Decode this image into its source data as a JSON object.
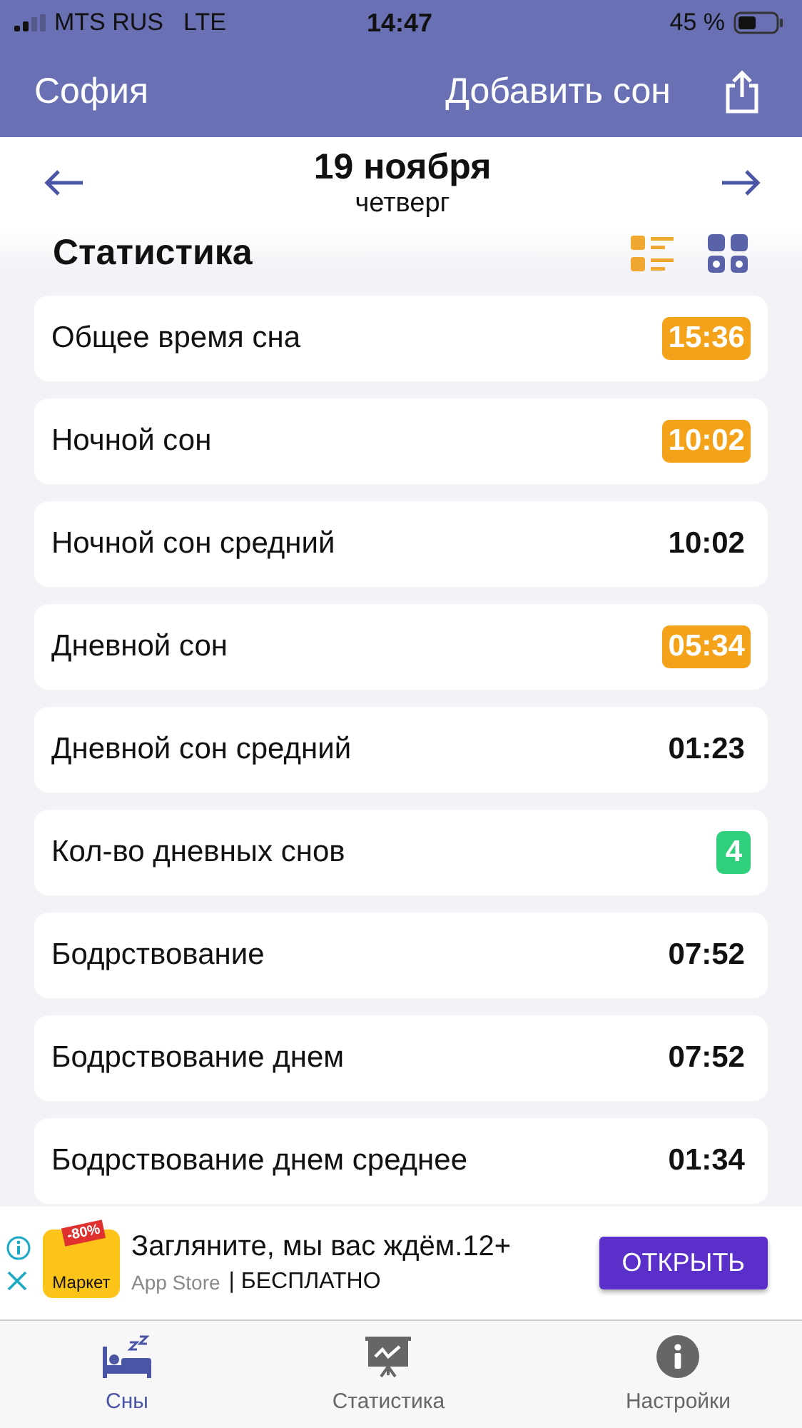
{
  "status_bar": {
    "carrier": "MTS RUS",
    "network": "LTE",
    "time": "14:47",
    "battery": "45 %"
  },
  "nav": {
    "title": "София",
    "action": "Добавить сон"
  },
  "date": {
    "day": "19 ноября",
    "weekday": "четверг"
  },
  "section": {
    "title": "Статистика",
    "views": [
      {
        "kind": "list",
        "selected": true
      },
      {
        "kind": "grid",
        "selected": false
      }
    ]
  },
  "rows": [
    {
      "label": "Общее время сна",
      "value": "15:36",
      "kind": "warning"
    },
    {
      "label": "Ночной сон",
      "value": "10:02",
      "kind": "warning"
    },
    {
      "label": "Ночной сон средний",
      "value": "10:02",
      "kind": "plain"
    },
    {
      "label": "Дневной сон",
      "value": "05:34",
      "kind": "warning"
    },
    {
      "label": "Дневной сон средний",
      "value": "01:23",
      "kind": "plain"
    },
    {
      "label": "Кол-во дневных снов",
      "value": "4",
      "kind": "count"
    },
    {
      "label": "Бодрствование",
      "value": "07:52",
      "kind": "plain"
    },
    {
      "label": "Бодрствование днем",
      "value": "07:52",
      "kind": "plain"
    },
    {
      "label": "Бодрствование днем среднее",
      "value": "01:34",
      "kind": "plain"
    }
  ],
  "ad": {
    "icon_badge": "-80%",
    "icon_label": "Маркет",
    "headline": "Загляните, мы вас ждём.12+",
    "store": "App Store",
    "price": "| БЕСПЛАТНО",
    "button": "ОТКРЫТЬ"
  },
  "tabs": [
    {
      "label": "Сны",
      "kind": "sleep",
      "selected": true
    },
    {
      "label": "Статистика",
      "kind": "stats",
      "selected": false
    },
    {
      "label": "Настройки",
      "kind": "info",
      "selected": false
    }
  ]
}
